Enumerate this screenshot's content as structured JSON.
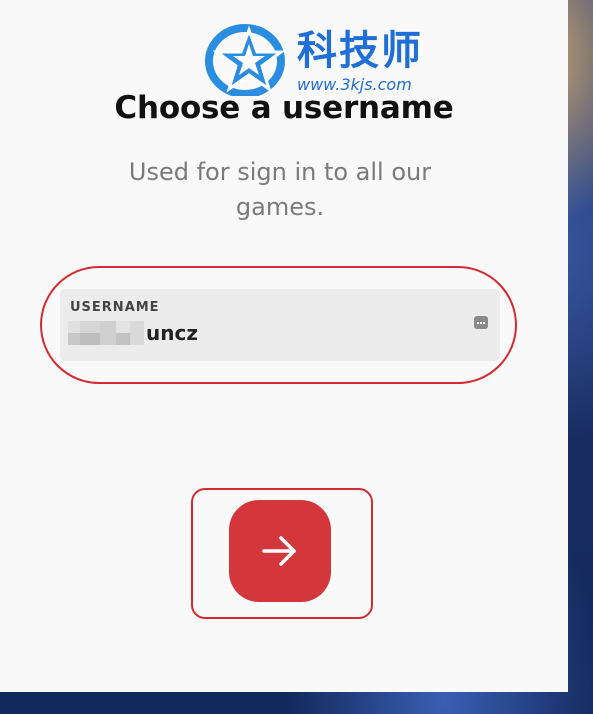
{
  "watermark": {
    "title": "科技师",
    "url": "www.3kjs.com"
  },
  "page": {
    "heading": "Choose a username",
    "subtitle": "Used for sign in to all our games."
  },
  "username_field": {
    "label": "USERNAME",
    "value": "uncz",
    "value_obscured": true
  },
  "actions": {
    "next_icon": "arrow-right-icon",
    "field_icon": "password-dots-icon"
  },
  "annotations": {
    "highlight_color": "#d52b33"
  },
  "colors": {
    "button": "#d4373b",
    "panel": "#f9f9f9",
    "field_bg": "#ececec"
  }
}
